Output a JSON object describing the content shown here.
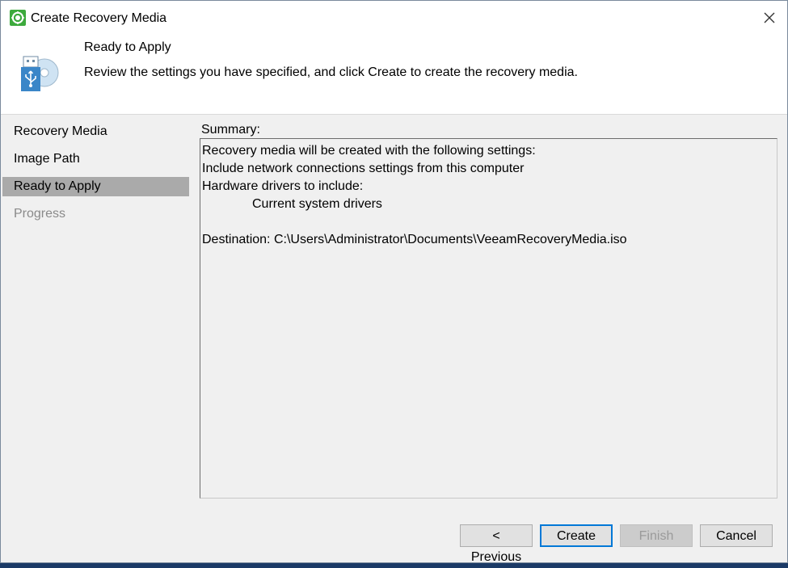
{
  "window": {
    "title": "Create Recovery Media"
  },
  "header": {
    "title": "Ready to Apply",
    "description": "Review the settings you have specified, and click Create to create the recovery media."
  },
  "nav": {
    "items": [
      {
        "label": "Recovery Media",
        "state": "normal"
      },
      {
        "label": "Image Path",
        "state": "normal"
      },
      {
        "label": "Ready to Apply",
        "state": "active"
      },
      {
        "label": "Progress",
        "state": "disabled"
      }
    ]
  },
  "summary": {
    "label": "Summary:",
    "lines": [
      "Recovery media will be created with the following settings:",
      "Include network connections settings from this computer",
      "Hardware drivers to include:",
      "Current system drivers",
      "",
      "Destination: C:\\Users\\Administrator\\Documents\\VeeamRecoveryMedia.iso"
    ]
  },
  "buttons": {
    "previous": "< Previous",
    "create": "Create",
    "finish": "Finish",
    "cancel": "Cancel"
  },
  "icons": {
    "app": "veeam-app-icon",
    "close": "close-icon",
    "header": "usb-recovery-disc-icon"
  },
  "colors": {
    "active_nav": "#aaaaaa",
    "default_button_border": "#0078d7",
    "app_icon_green": "#3daa3d"
  }
}
